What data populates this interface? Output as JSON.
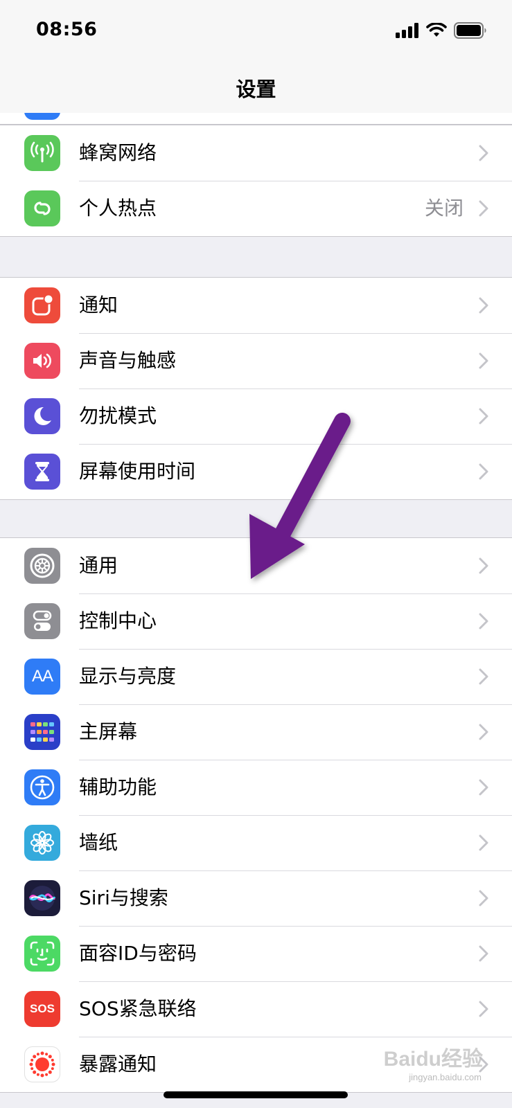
{
  "status_bar": {
    "time": "08:56"
  },
  "nav": {
    "title": "设置"
  },
  "groups": [
    {
      "items": [
        {
          "label": "蜂窝网络",
          "value": "",
          "icon": "cellular-icon",
          "color": "#5ac85a"
        },
        {
          "label": "个人热点",
          "value": "关闭",
          "icon": "hotspot-icon",
          "color": "#5ac85a"
        }
      ]
    },
    {
      "items": [
        {
          "label": "通知",
          "value": "",
          "icon": "notifications-icon",
          "color": "#ee4b3b"
        },
        {
          "label": "声音与触感",
          "value": "",
          "icon": "sound-icon",
          "color": "#ee4a5e"
        },
        {
          "label": "勿扰模式",
          "value": "",
          "icon": "moon-icon",
          "color": "#5a50d6"
        },
        {
          "label": "屏幕使用时间",
          "value": "",
          "icon": "hourglass-icon",
          "color": "#5a50d6"
        }
      ]
    },
    {
      "items": [
        {
          "label": "通用",
          "value": "",
          "icon": "gear-icon",
          "color": "#8e8e93"
        },
        {
          "label": "控制中心",
          "value": "",
          "icon": "toggle-icon",
          "color": "#8e8e93"
        },
        {
          "label": "显示与亮度",
          "value": "",
          "icon": "display-icon",
          "color": "#2f7cf6"
        },
        {
          "label": "主屏幕",
          "value": "",
          "icon": "home-screen-icon",
          "color": "#2a3fc8"
        },
        {
          "label": "辅助功能",
          "value": "",
          "icon": "accessibility-icon",
          "color": "#2f7cf6"
        },
        {
          "label": "墙纸",
          "value": "",
          "icon": "wallpaper-icon",
          "color": "#34aadc"
        },
        {
          "label": "Siri与搜索",
          "value": "",
          "icon": "siri-icon",
          "color": "#1c1c3a"
        },
        {
          "label": "面容ID与密码",
          "value": "",
          "icon": "face-id-icon",
          "color": "#4cd964"
        },
        {
          "label": "SOS紧急联络",
          "value": "",
          "icon": "sos-icon",
          "color": "#ee3b30"
        },
        {
          "label": "暴露通知",
          "value": "",
          "icon": "exposure-icon",
          "color": "#ffffff"
        }
      ]
    }
  ],
  "icon_text": {
    "display": "AA",
    "sos": "SOS"
  },
  "watermark": {
    "main": "Baidu经验",
    "sub": "jingyan.baidu.com"
  }
}
